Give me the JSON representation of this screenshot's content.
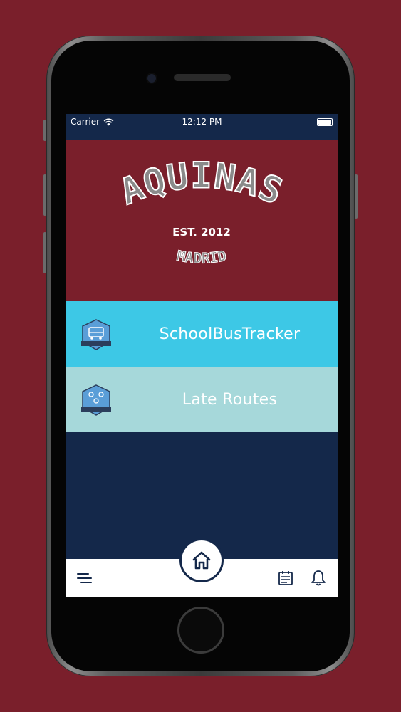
{
  "status_bar": {
    "carrier": "Carrier",
    "time": "12:12 PM"
  },
  "hero": {
    "school_name": "AQUINAS",
    "established": "EST. 2012",
    "city": "MADRID"
  },
  "menu": [
    {
      "label": "SchoolBusTracker",
      "icon": "bus-tracker-badge-icon",
      "badge_text": "BusTracker"
    },
    {
      "label": "Late Routes",
      "icon": "late-routes-badge-icon",
      "badge_text": "SchoolTracker"
    }
  ],
  "bottom_nav": {
    "left_icon": "menu-icon",
    "center_icon": "home-icon",
    "right_icons": [
      "calendar-icon",
      "bell-icon"
    ]
  },
  "colors": {
    "background": "#7a1f2b",
    "navy": "#14284a",
    "bus_row": "#3dc8e6",
    "late_row": "#a6d8da",
    "hero_text_gray": "#8a8a8a"
  }
}
